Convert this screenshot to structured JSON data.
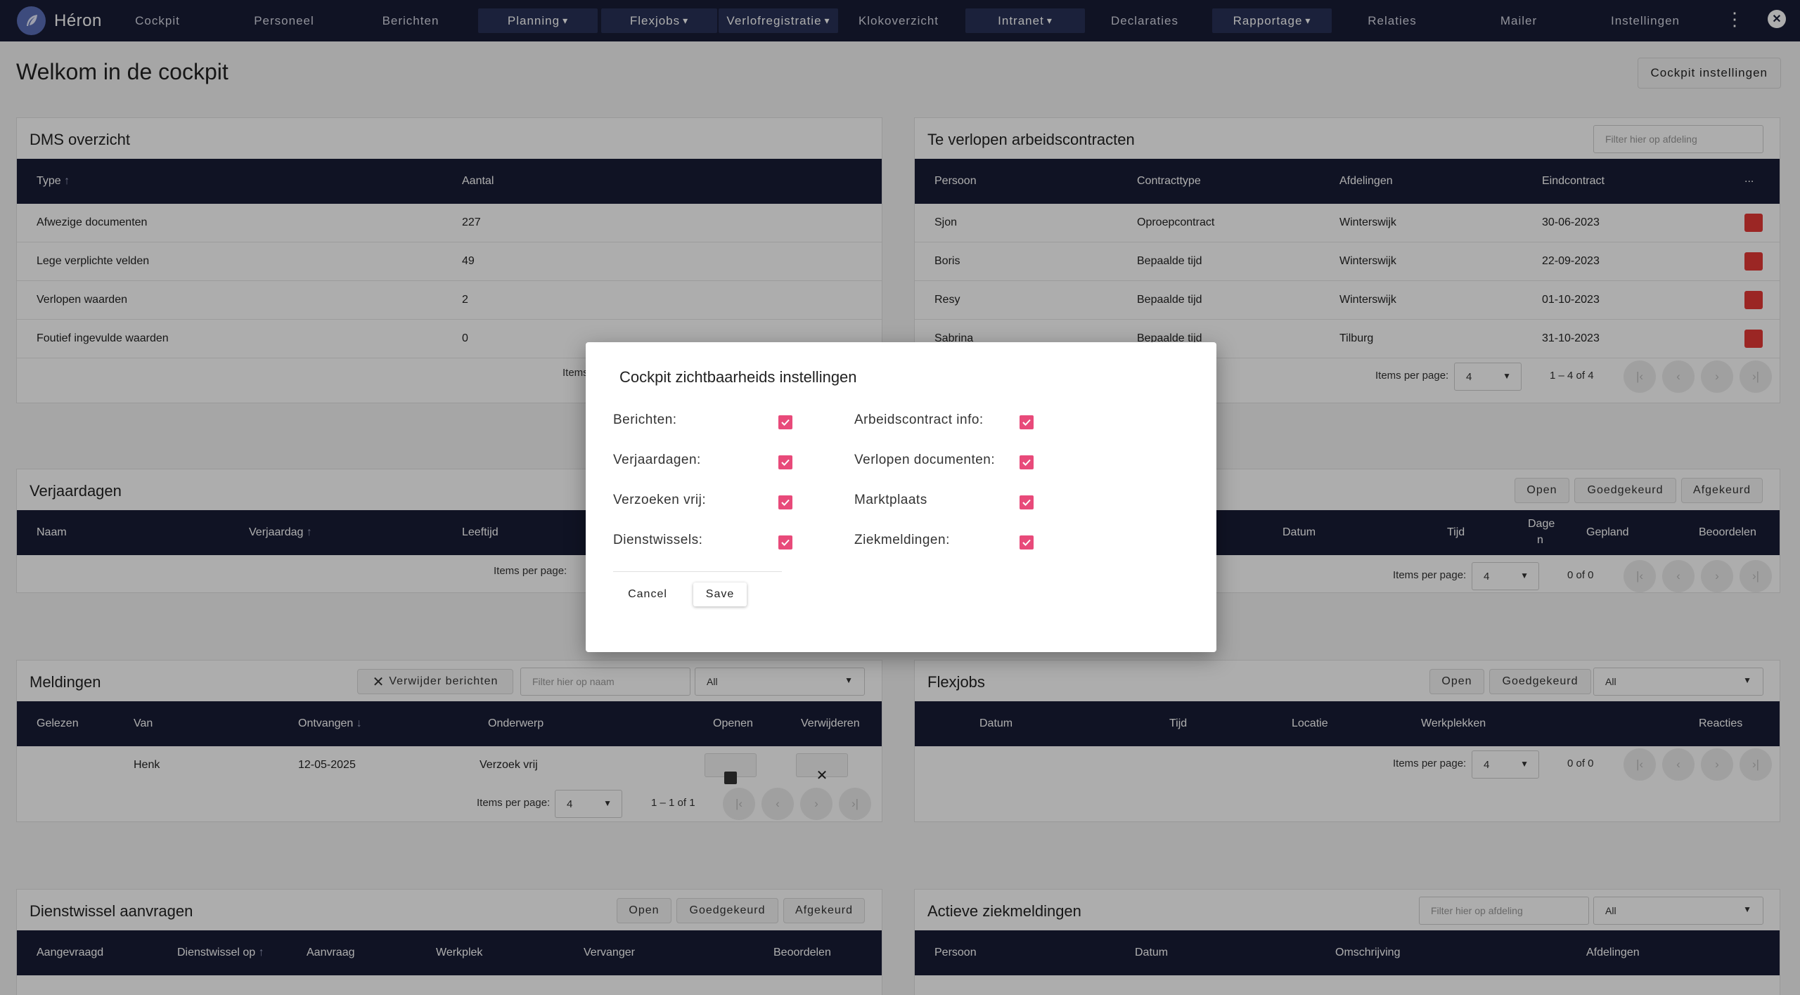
{
  "brand": {
    "name": "Héron"
  },
  "nav": {
    "cockpit": "Cockpit",
    "personeel": "Personeel",
    "berichten": "Berichten",
    "planning": "Planning",
    "flexjobs": "Flexjobs",
    "verlof": "Verlofregistratie",
    "kloko": "Klokoverzicht",
    "intranet": "Intranet",
    "declaraties": "Declaraties",
    "rapportage": "Rapportage",
    "relaties": "Relaties",
    "mailer": "Mailer",
    "instellingen": "Instellingen"
  },
  "page": {
    "title": "Welkom in de cockpit",
    "settings_button": "Cockpit instellingen"
  },
  "dms": {
    "title": "DMS overzicht",
    "columns": {
      "type": "Type",
      "aantal": "Aantal"
    },
    "rows": [
      {
        "type": "Afwezige documenten",
        "aantal": "227"
      },
      {
        "type": "Lege verplichte velden",
        "aantal": "49"
      },
      {
        "type": "Verlopen waarden",
        "aantal": "2"
      },
      {
        "type": "Foutief ingevulde waarden",
        "aantal": "0"
      }
    ],
    "items_label": "Items"
  },
  "contracts": {
    "title": "Te verlopen arbeidscontracten",
    "filter_placeholder": "Filter hier op afdeling",
    "columns": {
      "persoon": "Persoon",
      "type": "Contracttype",
      "afdeling": "Afdelingen",
      "eind": "Eindcontract",
      "more": "..."
    },
    "rows": [
      {
        "persoon": "Sjon",
        "type": "Oproepcontract",
        "afdeling": "Winterswijk",
        "eind": "30-06-2023"
      },
      {
        "persoon": "Boris",
        "type": "Bepaalde tijd",
        "afdeling": "Winterswijk",
        "eind": "22-09-2023"
      },
      {
        "persoon": "Resy",
        "type": "Bepaalde tijd",
        "afdeling": "Winterswijk",
        "eind": "01-10-2023"
      },
      {
        "persoon": "Sabrina",
        "type": "Bepaalde tijd",
        "afdeling": "Tilburg",
        "eind": "31-10-2023"
      }
    ],
    "pager": {
      "label": "Items per page:",
      "size": "4",
      "range": "1 – 4 of 4"
    }
  },
  "verjaardagen": {
    "title": "Verjaardagen",
    "columns": {
      "naam": "Naam",
      "verjaardag": "Verjaardag",
      "leeftijd": "Leeftijd"
    },
    "pager": {
      "label": "Items per page:"
    }
  },
  "verlof": {
    "chips": {
      "open": "Open",
      "goed": "Goedgekeurd",
      "af": "Afgekeurd"
    },
    "columns": {
      "datum": "Datum",
      "tijd": "Tijd",
      "dagen_a": "Dage",
      "dagen_b": "n",
      "gepland": "Gepland",
      "beoordelen": "Beoordelen"
    },
    "pager": {
      "label": "Items per page:",
      "size": "4",
      "range": "0 of 0"
    }
  },
  "meldingen": {
    "title": "Meldingen",
    "delete_button": "Verwijder berichten",
    "filter_placeholder": "Filter hier op naam",
    "dropdown": "All",
    "columns": {
      "gelezen": "Gelezen",
      "van": "Van",
      "ontvangen": "Ontvangen",
      "onderwerp": "Onderwerp",
      "openen": "Openen",
      "verwijderen": "Verwijderen"
    },
    "row": {
      "van": "Henk",
      "ontvangen": "12-05-2025",
      "onderwerp": "Verzoek vrij"
    },
    "pager": {
      "label": "Items per page:",
      "size": "4",
      "range": "1 – 1 of 1"
    }
  },
  "flexjobs": {
    "title": "Flexjobs",
    "chips": {
      "open": "Open",
      "goed": "Goedgekeurd"
    },
    "dropdown": "All",
    "columns": {
      "datum": "Datum",
      "tijd": "Tijd",
      "locatie": "Locatie",
      "werkplekken": "Werkplekken",
      "reacties": "Reacties"
    },
    "pager": {
      "label": "Items per page:",
      "size": "4",
      "range": "0 of 0"
    }
  },
  "dienstwissel": {
    "title": "Dienstwissel aanvragen",
    "chips": {
      "open": "Open",
      "goed": "Goedgekeurd",
      "af": "Afgekeurd"
    },
    "columns": {
      "aangevraagd": "Aangevraagd",
      "op": "Dienstwissel op",
      "aanvraag": "Aanvraag",
      "werkplek": "Werkplek",
      "vervanger": "Vervanger",
      "beoordelen": "Beoordelen"
    }
  },
  "ziekmeldingen": {
    "title": "Actieve ziekmeldingen",
    "filter_placeholder": "Filter hier op afdeling",
    "dropdown": "All",
    "columns": {
      "persoon": "Persoon",
      "datum": "Datum",
      "omschrijving": "Omschrijving",
      "afdelingen": "Afdelingen"
    }
  },
  "dialog": {
    "title": "Cockpit zichtbaarheids instellingen",
    "options_left": [
      {
        "label": "Berichten:",
        "checked": true
      },
      {
        "label": "Verjaardagen:",
        "checked": true
      },
      {
        "label": "Verzoeken vrij:",
        "checked": true
      },
      {
        "label": "Dienstwissels:",
        "checked": true
      }
    ],
    "options_right": [
      {
        "label": "Arbeidscontract info:",
        "checked": true
      },
      {
        "label": "Verlopen documenten:",
        "checked": true
      },
      {
        "label": "Marktplaats",
        "checked": true
      },
      {
        "label": "Ziekmeldingen:",
        "checked": true
      }
    ],
    "cancel": "Cancel",
    "save": "Save"
  },
  "colors": {
    "navbar": "#181c36",
    "accent_pink": "#e84a7a",
    "red": "#e53935"
  }
}
